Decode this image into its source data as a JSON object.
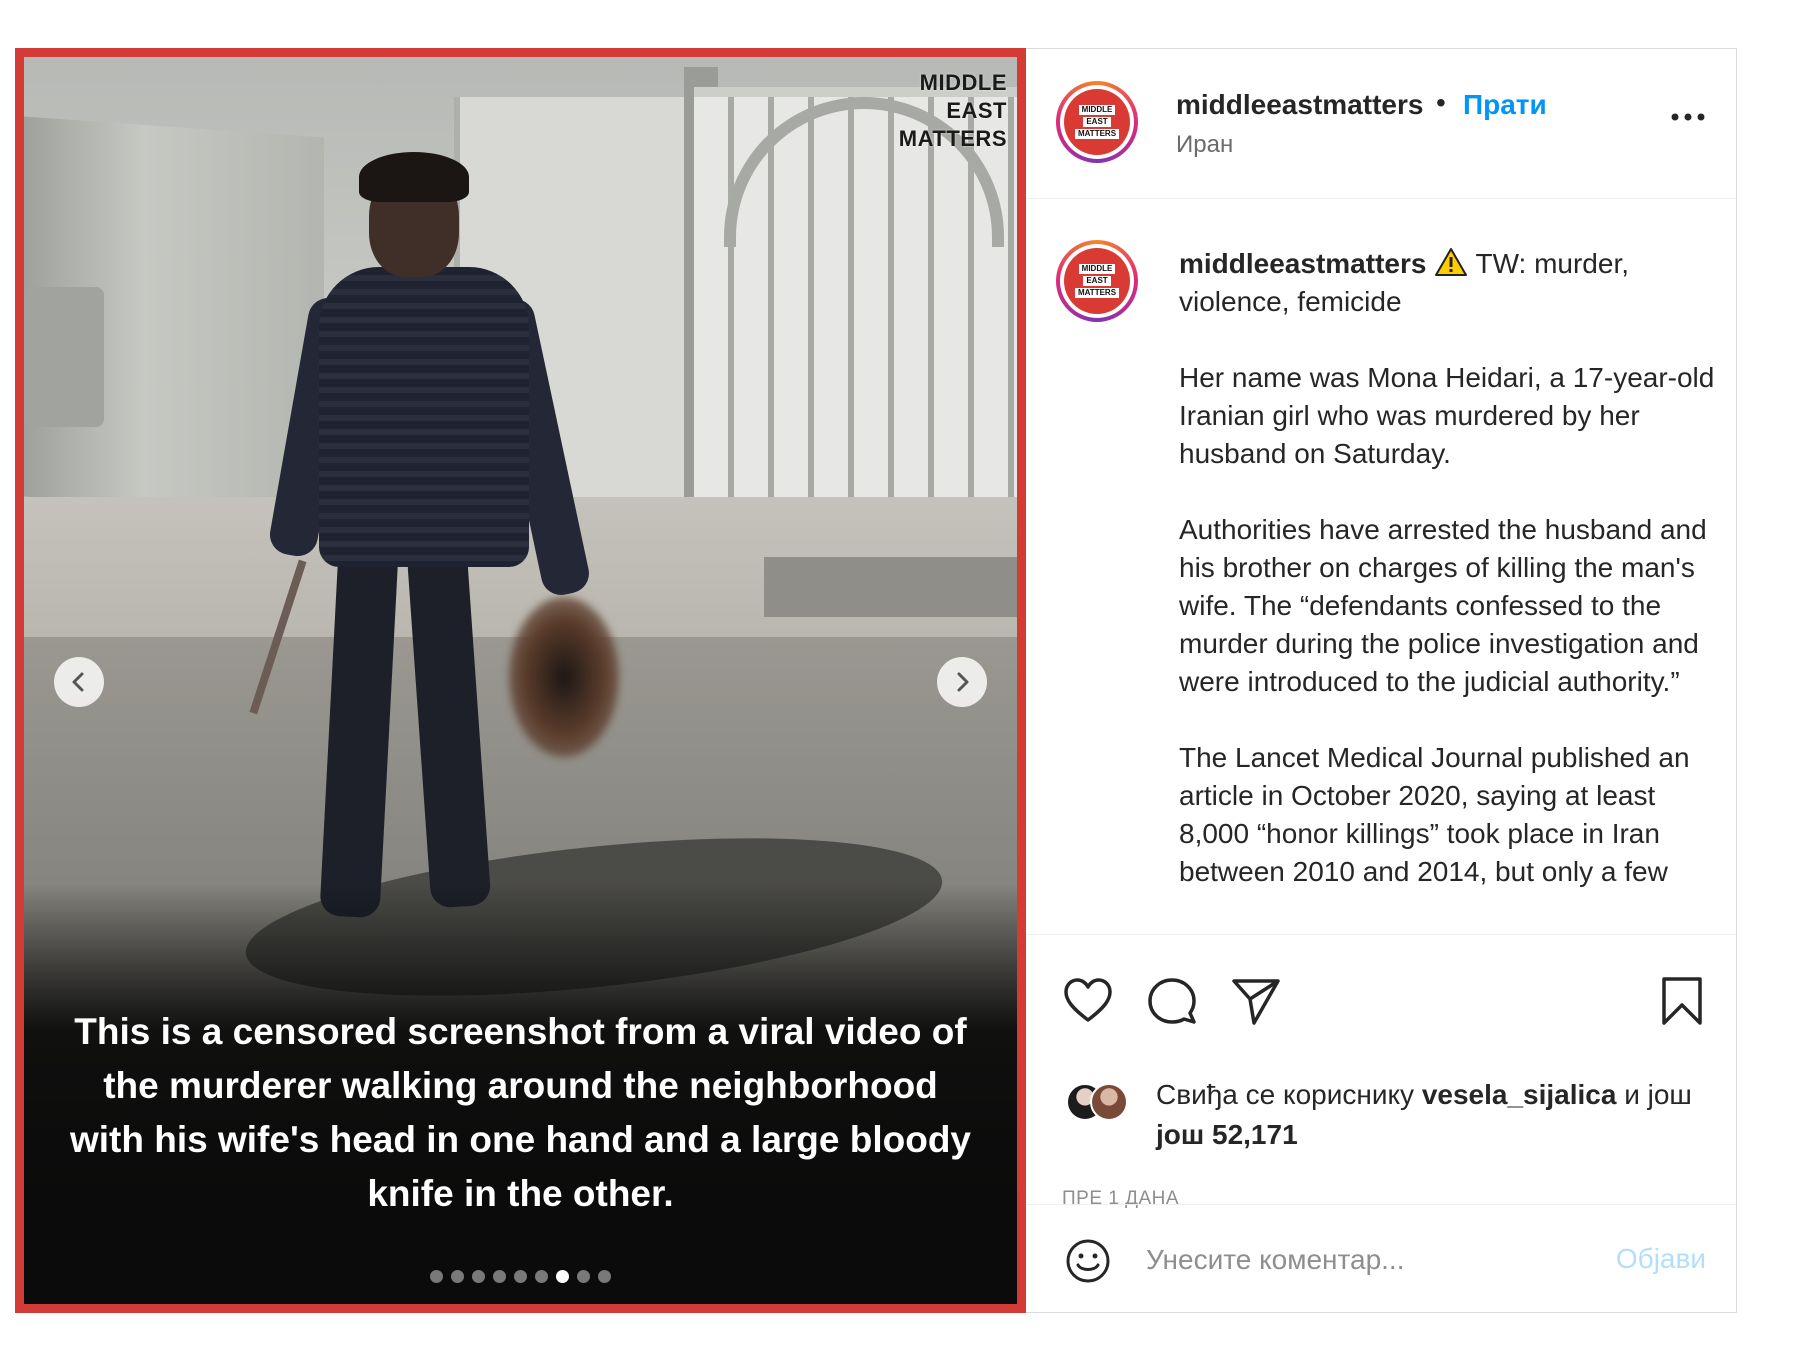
{
  "media": {
    "watermark": [
      "MIDDLE",
      "EAST",
      "MATTERS"
    ],
    "caption": "This is a censored screenshot from a viral video of the murderer walking around the neighborhood with his wife's head in one hand and a large bloody knife in the other.",
    "carousel": {
      "total_slides": 9,
      "active_index": 6
    }
  },
  "header": {
    "username": "middleeastmatters",
    "separator": "•",
    "follow_label": "Прати",
    "location": "Иран",
    "more_icon": "more-horizontal-icon"
  },
  "avatar_logo": [
    "MIDDLE",
    "EAST",
    "MATTERS"
  ],
  "post_caption": {
    "username": "middleeastmatters",
    "first_line": "TW: murder, violence, femicide",
    "paragraphs": [
      "Her name was Mona Heidari, a 17-year-old Iranian girl who was murdered by her husband on Saturday.",
      "Authorities have arrested the husband and his brother on charges of killing the man's wife. The “defendants confessed to the murder during the police investigation and were introduced to the judicial authority.”",
      "The Lancet Medical Journal published an article in October 2020, saying at least 8,000 “honor killings” took place in Iran between 2010 and 2014, but only a few"
    ]
  },
  "actions": {
    "like_icon": "heart-icon",
    "comment_icon": "comment-icon",
    "share_icon": "paper-plane-icon",
    "save_icon": "bookmark-icon"
  },
  "likes": {
    "prefix": "Свиђа се кориснику",
    "user": "vesela_sijalica",
    "middle": "и још",
    "count": "још 52,171"
  },
  "timestamp": "ПРЕ 1 ДАНА",
  "comment": {
    "placeholder": "Унесите коментар...",
    "post_label": "Објави"
  },
  "colors": {
    "frame_red": "#d23b36",
    "link_blue": "#0095f6",
    "post_button_disabled": "#b2dffc"
  }
}
